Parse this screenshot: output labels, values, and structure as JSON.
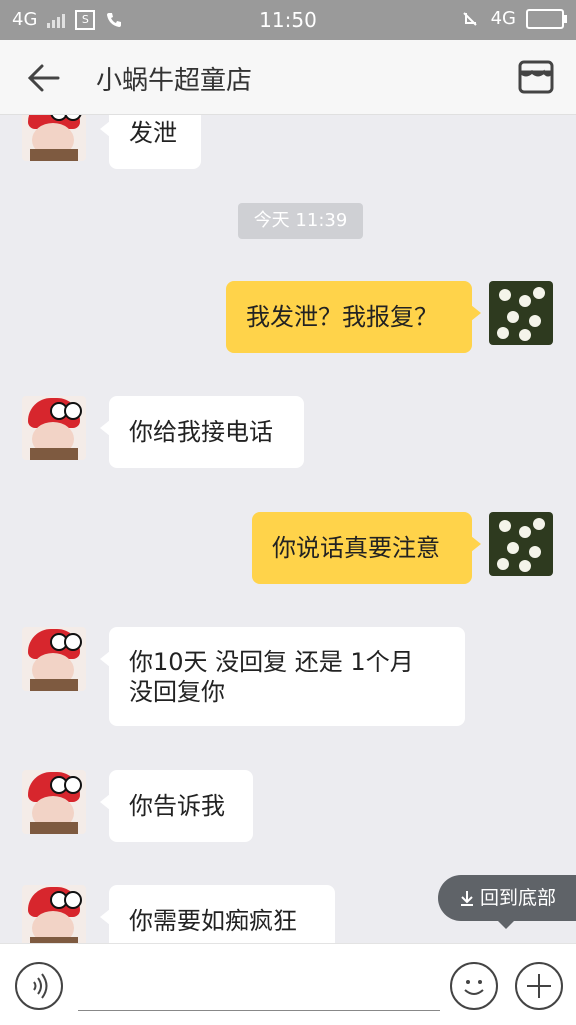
{
  "status_bar": {
    "network_left": "4G",
    "time": "11:50",
    "network_right": "4G"
  },
  "header": {
    "title": "小蜗牛超童店",
    "back_icon": "back-arrow-icon",
    "store_icon": "store-icon"
  },
  "chat": {
    "timestamp": "今天 11:39",
    "messages": [
      {
        "side": "in",
        "lines": [
          "发泄"
        ]
      },
      {
        "side": "out",
        "lines": [
          "我发泄？我报复？"
        ]
      },
      {
        "side": "in",
        "lines": [
          "你给我接电话"
        ]
      },
      {
        "side": "out",
        "lines": [
          "你说话真要注意"
        ]
      },
      {
        "side": "in",
        "lines": [
          "你10天 没回复 还是 1个月",
          "没回复你"
        ]
      },
      {
        "side": "in",
        "lines": [
          "你告诉我"
        ]
      },
      {
        "side": "in",
        "lines": [
          "你需要如痴疯狂"
        ]
      }
    ]
  },
  "back_to_bottom": {
    "label": "回到底部",
    "icon": "download-arrow-icon"
  },
  "input_bar": {
    "voice_icon": "voice-icon",
    "placeholder": "",
    "emoji_icon": "emoji-icon",
    "plus_icon": "plus-icon"
  }
}
